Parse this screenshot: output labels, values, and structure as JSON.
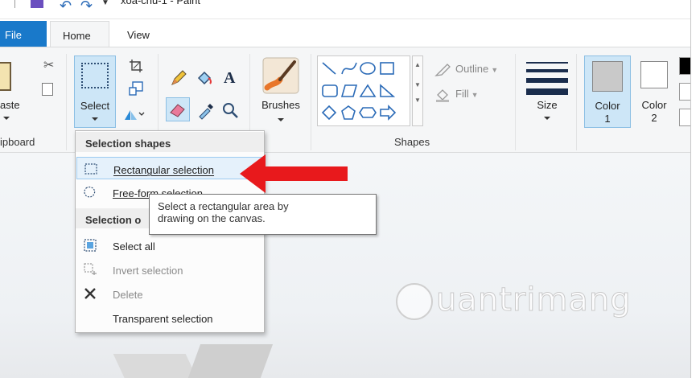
{
  "window": {
    "title": "xoa-chu-1 - Paint"
  },
  "tabs": {
    "file": "File",
    "home": "Home",
    "view": "View"
  },
  "clipboard": {
    "paste_label": "aste",
    "group_label": "ipboard"
  },
  "image": {
    "select_label": "Select"
  },
  "brushes": {
    "label": "Brushes"
  },
  "shapes": {
    "outline_label": "Outline",
    "fill_label": "Fill",
    "group_label": "Shapes"
  },
  "size": {
    "label": "Size"
  },
  "colors": {
    "color1_line1": "Color",
    "color1_line2": "1",
    "color2_line1": "Color",
    "color2_line2": "2",
    "color1_value": "#c9c9c9"
  },
  "selection_menu": {
    "header_shapes": "Selection shapes",
    "rectangular": "Rectangular selection",
    "freeform": "Free-form selection",
    "header_options": "Selection o",
    "select_all": "Select all",
    "invert": "Invert selection",
    "delete": "Delete",
    "transparent": "Transparent selection"
  },
  "tooltip": {
    "line1": "Select a rectangular area by",
    "line2": "drawing on the canvas."
  },
  "watermark": {
    "text": "uantrimang"
  },
  "accent": {
    "file_tab": "#1979ca",
    "annotation_arrow": "#e8191c",
    "selected_button": "#cde6f7"
  }
}
